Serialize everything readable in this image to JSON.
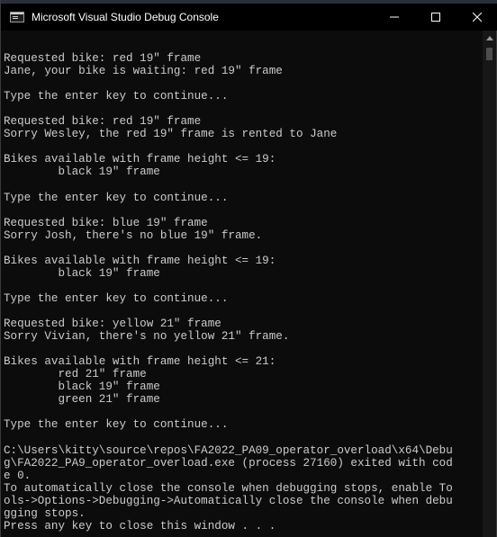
{
  "window": {
    "title": "Microsoft Visual Studio Debug Console",
    "icon": "console-app-icon",
    "controls": {
      "minimize_icon": "minimize-icon",
      "maximize_icon": "maximize-icon",
      "close_icon": "close-icon"
    }
  },
  "console": {
    "lines": [
      "",
      "Requested bike: red 19\" frame",
      "Jane, your bike is waiting: red 19\" frame",
      "",
      "Type the enter key to continue...",
      "",
      "Requested bike: red 19\" frame",
      "Sorry Wesley, the red 19\" frame is rented to Jane",
      "",
      "Bikes available with frame height <= 19:",
      "        black 19\" frame",
      "",
      "Type the enter key to continue...",
      "",
      "Requested bike: blue 19\" frame",
      "Sorry Josh, there's no blue 19\" frame.",
      "",
      "Bikes available with frame height <= 19:",
      "        black 19\" frame",
      "",
      "Type the enter key to continue...",
      "",
      "Requested bike: yellow 21\" frame",
      "Sorry Vivian, there's no yellow 21\" frame.",
      "",
      "Bikes available with frame height <= 21:",
      "        red 21\" frame",
      "        black 19\" frame",
      "        green 21\" frame",
      "",
      "Type the enter key to continue...",
      "",
      "C:\\Users\\kitty\\source\\repos\\FA2022_PA09_operator_overload\\x64\\Debu",
      "g\\FA2022_PA9_operator_overload.exe (process 27160) exited with cod",
      "e 0.",
      "To automatically close the console when debugging stops, enable To",
      "ols->Options->Debugging->Automatically close the console when debu",
      "gging stops.",
      "Press any key to close this window . . ."
    ]
  },
  "colors": {
    "console_background": "#0c0c0c",
    "console_text": "#cccccc",
    "titlebar_background": "#000000",
    "titlebar_text": "#ffffff"
  }
}
